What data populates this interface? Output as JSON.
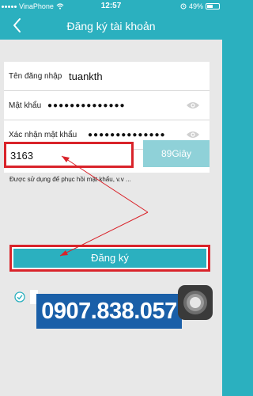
{
  "status": {
    "carrier": "VinaPhone",
    "time": "12:57",
    "battery": "49%"
  },
  "nav": {
    "title": "Đăng ký tài khoản"
  },
  "form": {
    "username_label": "Tên đăng nhập",
    "username_value": "tuankth",
    "password_label": "Mật khẩu",
    "password_value": "●●●●●●●●●●●●●●",
    "confirm_label": "Xác nhận mật khẩu",
    "confirm_value": "●●●●●●●●●●●●●●"
  },
  "verification": {
    "code_value": "3163",
    "timer_label": "89Giây",
    "hint": "Được sử dụng để phục hồi mật khẩu, v.v ..."
  },
  "actions": {
    "register_label": "Đăng ký"
  },
  "overlay": {
    "phone_number": "0907.838.057"
  },
  "colors": {
    "primary": "#2bb0bf",
    "highlight": "#d9232a",
    "banner": "#1a5fa8"
  }
}
